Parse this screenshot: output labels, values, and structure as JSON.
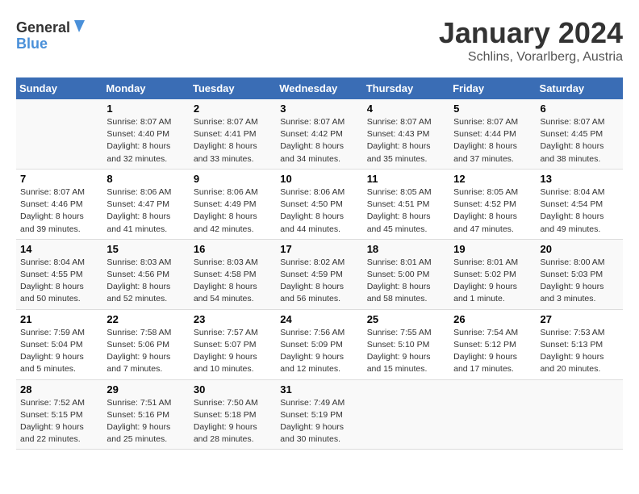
{
  "logo": {
    "line1": "General",
    "line2": "Blue"
  },
  "title": "January 2024",
  "subtitle": "Schlins, Vorarlberg, Austria",
  "days_of_week": [
    "Sunday",
    "Monday",
    "Tuesday",
    "Wednesday",
    "Thursday",
    "Friday",
    "Saturday"
  ],
  "weeks": [
    [
      {
        "day": "",
        "info": ""
      },
      {
        "day": "1",
        "info": "Sunrise: 8:07 AM\nSunset: 4:40 PM\nDaylight: 8 hours\nand 32 minutes."
      },
      {
        "day": "2",
        "info": "Sunrise: 8:07 AM\nSunset: 4:41 PM\nDaylight: 8 hours\nand 33 minutes."
      },
      {
        "day": "3",
        "info": "Sunrise: 8:07 AM\nSunset: 4:42 PM\nDaylight: 8 hours\nand 34 minutes."
      },
      {
        "day": "4",
        "info": "Sunrise: 8:07 AM\nSunset: 4:43 PM\nDaylight: 8 hours\nand 35 minutes."
      },
      {
        "day": "5",
        "info": "Sunrise: 8:07 AM\nSunset: 4:44 PM\nDaylight: 8 hours\nand 37 minutes."
      },
      {
        "day": "6",
        "info": "Sunrise: 8:07 AM\nSunset: 4:45 PM\nDaylight: 8 hours\nand 38 minutes."
      }
    ],
    [
      {
        "day": "7",
        "info": "Sunrise: 8:07 AM\nSunset: 4:46 PM\nDaylight: 8 hours\nand 39 minutes."
      },
      {
        "day": "8",
        "info": "Sunrise: 8:06 AM\nSunset: 4:47 PM\nDaylight: 8 hours\nand 41 minutes."
      },
      {
        "day": "9",
        "info": "Sunrise: 8:06 AM\nSunset: 4:49 PM\nDaylight: 8 hours\nand 42 minutes."
      },
      {
        "day": "10",
        "info": "Sunrise: 8:06 AM\nSunset: 4:50 PM\nDaylight: 8 hours\nand 44 minutes."
      },
      {
        "day": "11",
        "info": "Sunrise: 8:05 AM\nSunset: 4:51 PM\nDaylight: 8 hours\nand 45 minutes."
      },
      {
        "day": "12",
        "info": "Sunrise: 8:05 AM\nSunset: 4:52 PM\nDaylight: 8 hours\nand 47 minutes."
      },
      {
        "day": "13",
        "info": "Sunrise: 8:04 AM\nSunset: 4:54 PM\nDaylight: 8 hours\nand 49 minutes."
      }
    ],
    [
      {
        "day": "14",
        "info": "Sunrise: 8:04 AM\nSunset: 4:55 PM\nDaylight: 8 hours\nand 50 minutes."
      },
      {
        "day": "15",
        "info": "Sunrise: 8:03 AM\nSunset: 4:56 PM\nDaylight: 8 hours\nand 52 minutes."
      },
      {
        "day": "16",
        "info": "Sunrise: 8:03 AM\nSunset: 4:58 PM\nDaylight: 8 hours\nand 54 minutes."
      },
      {
        "day": "17",
        "info": "Sunrise: 8:02 AM\nSunset: 4:59 PM\nDaylight: 8 hours\nand 56 minutes."
      },
      {
        "day": "18",
        "info": "Sunrise: 8:01 AM\nSunset: 5:00 PM\nDaylight: 8 hours\nand 58 minutes."
      },
      {
        "day": "19",
        "info": "Sunrise: 8:01 AM\nSunset: 5:02 PM\nDaylight: 9 hours\nand 1 minute."
      },
      {
        "day": "20",
        "info": "Sunrise: 8:00 AM\nSunset: 5:03 PM\nDaylight: 9 hours\nand 3 minutes."
      }
    ],
    [
      {
        "day": "21",
        "info": "Sunrise: 7:59 AM\nSunset: 5:04 PM\nDaylight: 9 hours\nand 5 minutes."
      },
      {
        "day": "22",
        "info": "Sunrise: 7:58 AM\nSunset: 5:06 PM\nDaylight: 9 hours\nand 7 minutes."
      },
      {
        "day": "23",
        "info": "Sunrise: 7:57 AM\nSunset: 5:07 PM\nDaylight: 9 hours\nand 10 minutes."
      },
      {
        "day": "24",
        "info": "Sunrise: 7:56 AM\nSunset: 5:09 PM\nDaylight: 9 hours\nand 12 minutes."
      },
      {
        "day": "25",
        "info": "Sunrise: 7:55 AM\nSunset: 5:10 PM\nDaylight: 9 hours\nand 15 minutes."
      },
      {
        "day": "26",
        "info": "Sunrise: 7:54 AM\nSunset: 5:12 PM\nDaylight: 9 hours\nand 17 minutes."
      },
      {
        "day": "27",
        "info": "Sunrise: 7:53 AM\nSunset: 5:13 PM\nDaylight: 9 hours\nand 20 minutes."
      }
    ],
    [
      {
        "day": "28",
        "info": "Sunrise: 7:52 AM\nSunset: 5:15 PM\nDaylight: 9 hours\nand 22 minutes."
      },
      {
        "day": "29",
        "info": "Sunrise: 7:51 AM\nSunset: 5:16 PM\nDaylight: 9 hours\nand 25 minutes."
      },
      {
        "day": "30",
        "info": "Sunrise: 7:50 AM\nSunset: 5:18 PM\nDaylight: 9 hours\nand 28 minutes."
      },
      {
        "day": "31",
        "info": "Sunrise: 7:49 AM\nSunset: 5:19 PM\nDaylight: 9 hours\nand 30 minutes."
      },
      {
        "day": "",
        "info": ""
      },
      {
        "day": "",
        "info": ""
      },
      {
        "day": "",
        "info": ""
      }
    ]
  ]
}
